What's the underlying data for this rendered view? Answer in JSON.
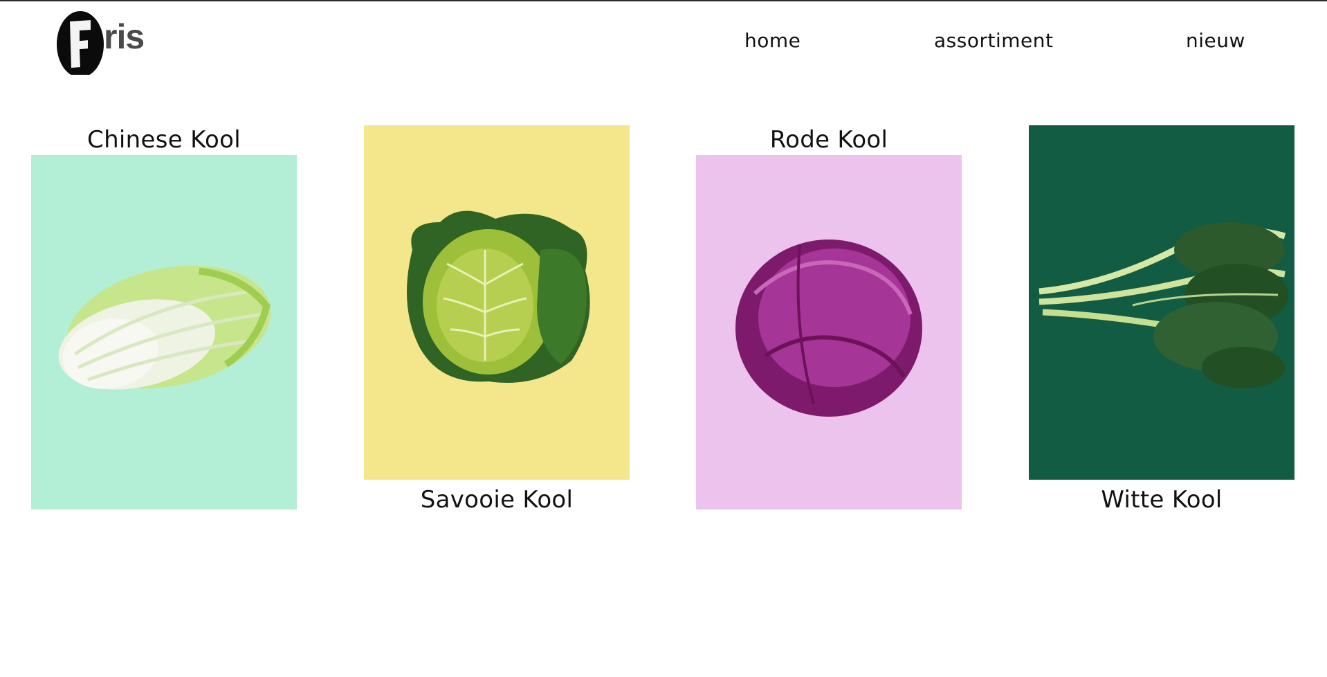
{
  "header": {
    "logo_text": "Fris",
    "nav": [
      {
        "label": "home"
      },
      {
        "label": "assortiment"
      },
      {
        "label": "nieuw"
      }
    ]
  },
  "products": [
    {
      "name": "Chinese Kool",
      "bg_color": "#b3eed7",
      "image": "chinese-cabbage"
    },
    {
      "name": "Savooie Kool",
      "bg_color": "#f3e68b",
      "image": "savoy-cabbage"
    },
    {
      "name": "Rode Kool",
      "bg_color": "#ecc3ed",
      "image": "red-cabbage"
    },
    {
      "name": "Witte Kool",
      "bg_color": "#115c43",
      "image": "kale-bunch"
    }
  ]
}
